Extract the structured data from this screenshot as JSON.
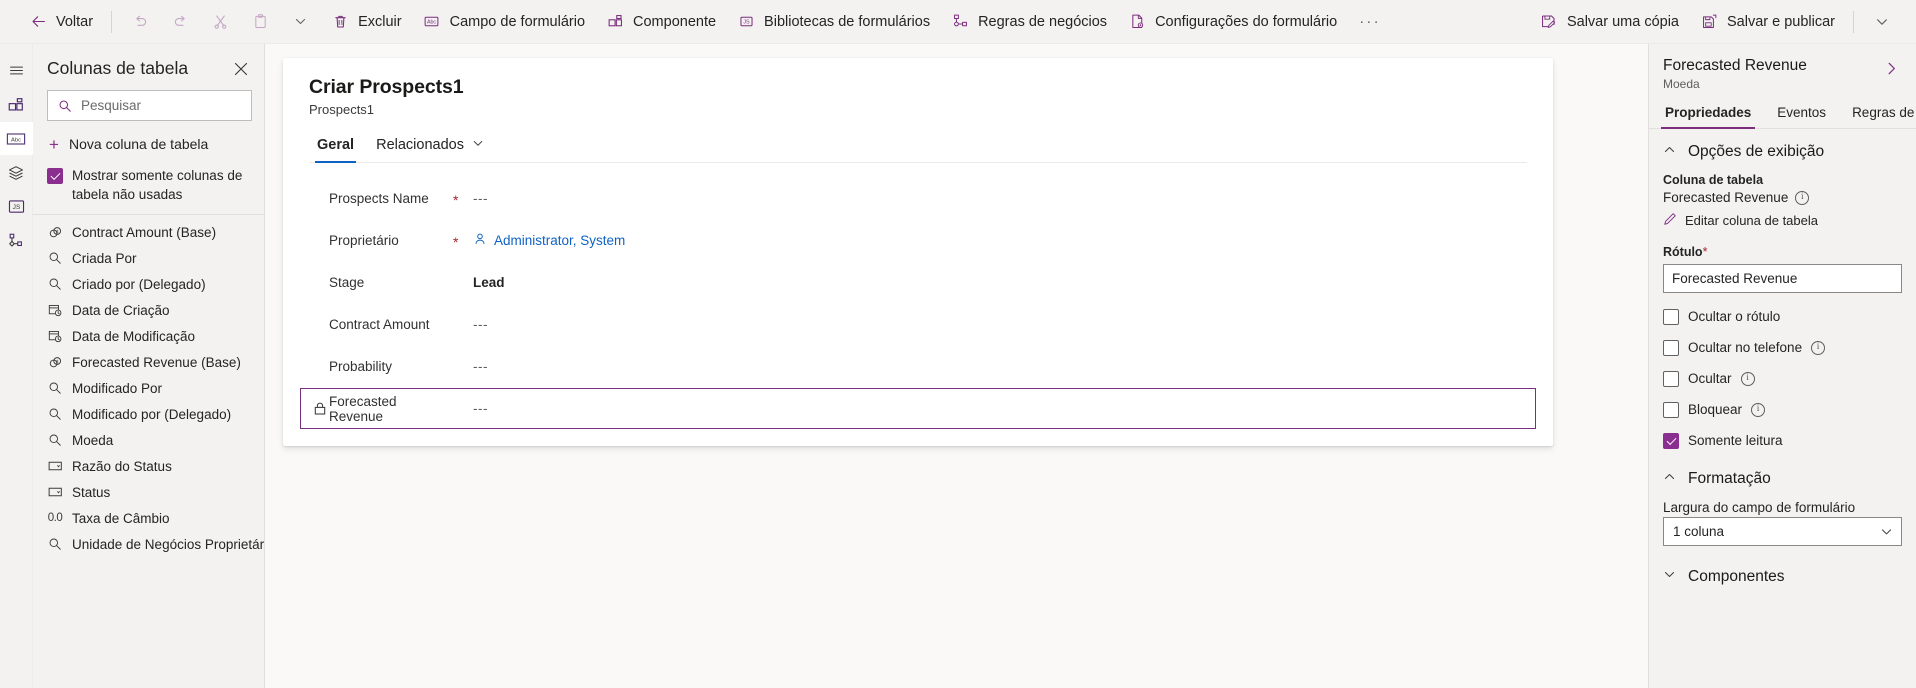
{
  "commandbar": {
    "left": [
      {
        "label": "Voltar",
        "icon": "back-arrow-icon",
        "disabled": false
      },
      {
        "label": "",
        "icon": "undo-icon",
        "disabled": true
      },
      {
        "label": "",
        "icon": "redo-icon",
        "disabled": true
      },
      {
        "label": "",
        "icon": "cut-icon",
        "disabled": true
      },
      {
        "label": "",
        "icon": "paste-icon",
        "disabled": true
      },
      {
        "label": "",
        "icon": "chevron-down-icon",
        "disabled": false
      },
      {
        "label": "Excluir",
        "icon": "trash-icon",
        "disabled": false
      },
      {
        "label": "Campo de formulário",
        "icon": "form-field-icon",
        "disabled": false
      },
      {
        "label": "Componente",
        "icon": "component-icon",
        "disabled": false
      },
      {
        "label": "Bibliotecas de formulários",
        "icon": "js-library-icon",
        "disabled": false
      },
      {
        "label": "Regras de negócios",
        "icon": "business-rules-icon",
        "disabled": false
      },
      {
        "label": "Configurações do formulário",
        "icon": "form-settings-icon",
        "disabled": false
      }
    ],
    "overflow_label": "···",
    "right": [
      {
        "label": "Salvar uma cópia",
        "icon": "save-copy-icon"
      },
      {
        "label": "Salvar e publicar",
        "icon": "save-publish-icon"
      },
      {
        "label": "",
        "icon": "chevron-down-icon"
      }
    ]
  },
  "rail": {
    "items": [
      {
        "name": "hamburger-menu-icon"
      },
      {
        "name": "components-tree-icon"
      },
      {
        "name": "table-columns-icon",
        "selected": true
      },
      {
        "name": "layers-icon"
      },
      {
        "name": "js-library-icon"
      },
      {
        "name": "business-rules-icon"
      }
    ]
  },
  "table_columns_panel": {
    "title": "Colunas de tabela",
    "close_label": "×",
    "search": {
      "placeholder": "Pesquisar",
      "value": ""
    },
    "new_column_label": "Nova coluna de tabela",
    "show_unused_label": "Mostrar somente colunas de tabela não usadas",
    "show_unused_checked": true,
    "columns": [
      {
        "label": "Contract Amount (Base)",
        "icon": "currency-icon"
      },
      {
        "label": "Criada Por",
        "icon": "lookup-icon"
      },
      {
        "label": "Criado por (Delegado)",
        "icon": "lookup-icon"
      },
      {
        "label": "Data de Criação",
        "icon": "datetime-icon"
      },
      {
        "label": "Data de Modificação",
        "icon": "datetime-icon"
      },
      {
        "label": "Forecasted Revenue (Base)",
        "icon": "currency-icon"
      },
      {
        "label": "Modificado Por",
        "icon": "lookup-icon"
      },
      {
        "label": "Modificado por (Delegado)",
        "icon": "lookup-icon"
      },
      {
        "label": "Moeda",
        "icon": "lookup-icon"
      },
      {
        "label": "Razão do Status",
        "icon": "choice-icon"
      },
      {
        "label": "Status",
        "icon": "choice-icon"
      },
      {
        "label": "Taxa de Câmbio",
        "icon": "decimal-icon"
      },
      {
        "label": "Unidade de Negócios Proprietária",
        "icon": "lookup-icon"
      }
    ]
  },
  "form": {
    "title": "Criar Prospects1",
    "subtitle": "Prospects1",
    "tabs": [
      {
        "label": "Geral",
        "active": true,
        "has_chevron": false
      },
      {
        "label": "Relacionados",
        "active": false,
        "has_chevron": true
      }
    ],
    "accent_tab_color": "#0f62c4",
    "fields": [
      {
        "label": "Prospects Name",
        "required": true,
        "value": "---",
        "value_style": "dim",
        "locked": false
      },
      {
        "label": "Proprietário",
        "required": true,
        "value": "Administrator, System",
        "value_style": "link",
        "locked": false,
        "icon": "person-icon"
      },
      {
        "label": "Stage",
        "required": false,
        "value": "Lead",
        "value_style": "bold",
        "locked": false
      },
      {
        "label": "Contract Amount",
        "required": false,
        "value": "---",
        "value_style": "dim",
        "locked": false
      },
      {
        "label": "Probability",
        "required": false,
        "value": "---",
        "value_style": "dim",
        "locked": false
      },
      {
        "label": "Forecasted Revenue",
        "required": false,
        "value": "---",
        "value_style": "dim",
        "locked": true,
        "selected": true
      }
    ],
    "selection_color": "#7b2d7e"
  },
  "properties": {
    "title": "Forecasted Revenue",
    "subtitle": "Moeda",
    "expand_icon": "chevron-right-icon",
    "tabs": [
      {
        "label": "Propriedades",
        "active": true
      },
      {
        "label": "Eventos",
        "active": false
      },
      {
        "label": "Regras de n",
        "active": false
      }
    ],
    "accent_color": "#7b2d7e",
    "display_options": {
      "section_title": "Opções de exibição",
      "collapsed": false,
      "table_column_label": "Coluna de tabela",
      "table_column_value": "Forecasted Revenue",
      "edit_link": "Editar coluna de tabela",
      "label_field_label": "Rótulo",
      "label_field_required": "*",
      "label_field_value": "Forecasted Revenue",
      "checkboxes": [
        {
          "label": "Ocultar o rótulo",
          "checked": false,
          "info": false
        },
        {
          "label": "Ocultar no telefone",
          "checked": false,
          "info": true
        },
        {
          "label": "Ocultar",
          "checked": false,
          "info": true
        },
        {
          "label": "Bloquear",
          "checked": false,
          "info": true
        },
        {
          "label": "Somente leitura",
          "checked": true,
          "info": false
        }
      ]
    },
    "formatting": {
      "section_title": "Formatação",
      "collapsed": false,
      "width_label": "Largura do campo de formulário",
      "width_value": "1 coluna"
    },
    "components": {
      "section_title": "Componentes",
      "collapsed": true
    }
  }
}
